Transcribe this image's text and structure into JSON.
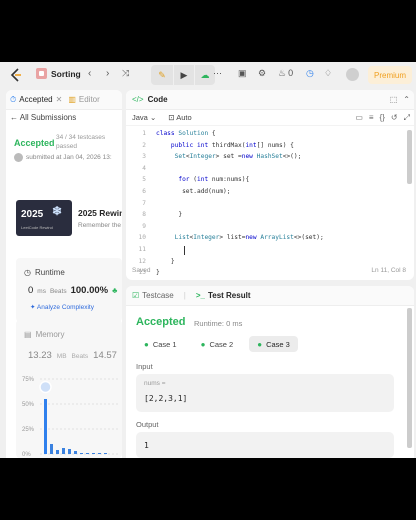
{
  "header": {
    "problem_name": "Sorting",
    "premium_label": "Premium",
    "fire_count": "0"
  },
  "left": {
    "tab_accepted": "Accepted",
    "tab_editor": "Editor",
    "all_submissions": "All Submissions",
    "status": "Accepted",
    "testcases": "34 / 34 testcases passed",
    "submitted": "submitted at Jan 04, 2026 13:",
    "rewind_year": "2025",
    "rewind_small": "LeetCode Rewind",
    "rewind_title": "2025 Rewind",
    "rewind_sub": "Remember the",
    "runtime_label": "Runtime",
    "runtime_value": "0",
    "runtime_unit": "ms",
    "runtime_beats": "Beats",
    "runtime_pct": "100.00%",
    "analyze": "Analyze Complexity",
    "memory_label": "Memory",
    "memory_value": "13.23",
    "memory_unit": "MB",
    "memory_beats": "Beats",
    "memory_pct": "14.57",
    "chart_ticks": [
      "75%",
      "50%",
      "25%",
      "0%"
    ]
  },
  "chart_data": {
    "type": "bar",
    "title": "",
    "xlabel": "",
    "ylabel": "",
    "ylim": [
      0,
      80
    ],
    "yticks": [
      "0%",
      "25%",
      "50%",
      "75%"
    ],
    "values": [
      55,
      10,
      4,
      6,
      5,
      3,
      1,
      1,
      1,
      1,
      1
    ],
    "highlight_index": 0
  },
  "code": {
    "title": "Code",
    "language": "Java",
    "mode": "Auto",
    "saved": "Saved",
    "position": "Ln 11, Col 8",
    "lines": [
      {
        "n": "1",
        "t": "class Solution {"
      },
      {
        "n": "2",
        "t": "    public int thirdMax(int[] nums) {"
      },
      {
        "n": "3",
        "t": "     Set<Integer> set =new HashSet<>();"
      },
      {
        "n": "4",
        "t": ""
      },
      {
        "n": "5",
        "t": "      for (int num:nums){"
      },
      {
        "n": "6",
        "t": "       set.add(num);"
      },
      {
        "n": "7",
        "t": ""
      },
      {
        "n": "8",
        "t": "      }"
      },
      {
        "n": "9",
        "t": ""
      },
      {
        "n": "10",
        "t": "     List<Integer> list=new ArrayList<>(set);"
      },
      {
        "n": "11",
        "t": ""
      },
      {
        "n": "12",
        "t": "    }"
      },
      {
        "n": "13",
        "t": "}"
      }
    ]
  },
  "result": {
    "tab_testcase": "Testcase",
    "tab_result": "Test Result",
    "status": "Accepted",
    "runtime": "Runtime: 0 ms",
    "cases": [
      "Case 1",
      "Case 2",
      "Case 3"
    ],
    "input_label": "Input",
    "input_key": "nums =",
    "input_value": "[2,2,3,1]",
    "output_label": "Output",
    "output_value": "1"
  }
}
